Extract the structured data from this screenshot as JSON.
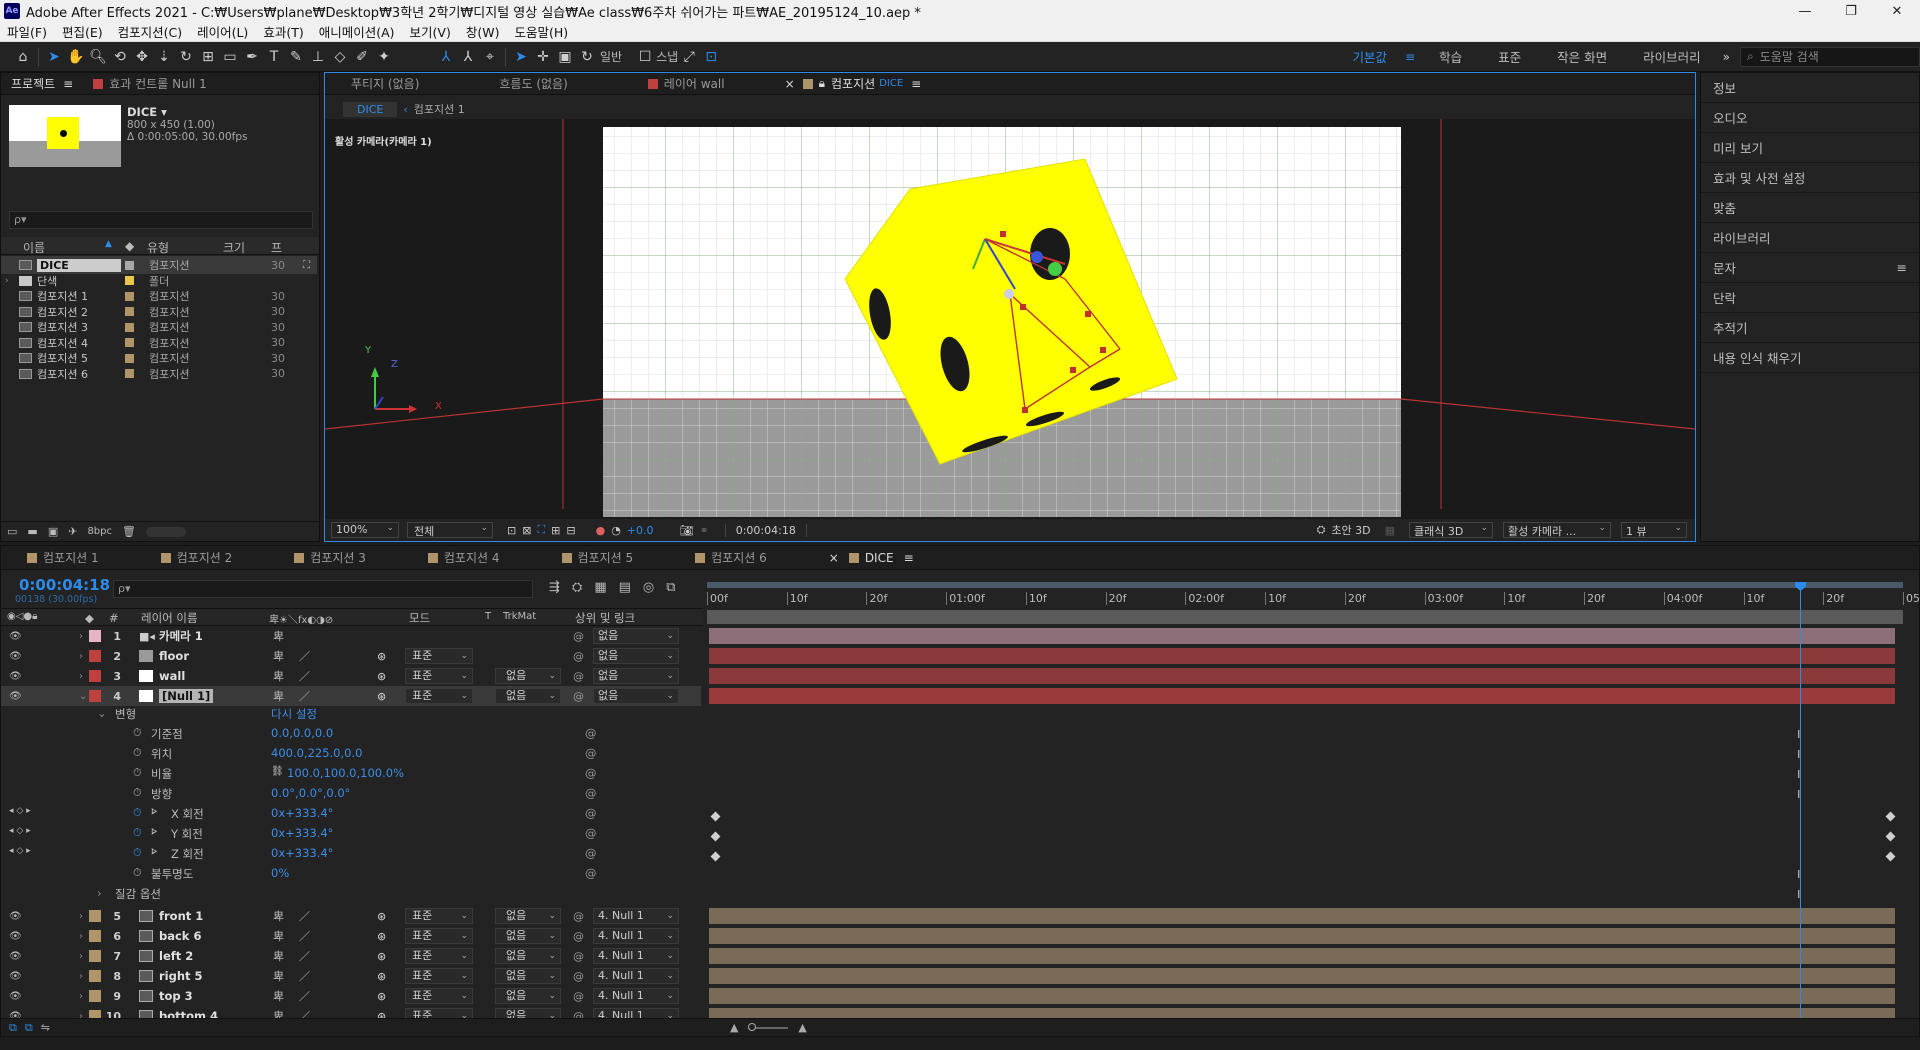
{
  "window": {
    "app_icon": "Ae",
    "title": "Adobe After Effects 2021 - C:₩Users₩plane₩Desktop₩3학년 2학기₩디지털 영상 실습₩Ae class₩6주차 쉬어가는 파트₩AE_20195124_10.aep *",
    "min": "—",
    "max": "❐",
    "close": "✕"
  },
  "menu": [
    "파일(F)",
    "편집(E)",
    "컴포지션(C)",
    "레이어(L)",
    "효과(T)",
    "애니메이션(A)",
    "보기(V)",
    "창(W)",
    "도움말(H)"
  ],
  "toolbar": {
    "snap_label": "스냅",
    "mode_label": "일반",
    "workspaces": [
      "기본값",
      "학습",
      "표준",
      "작은 화면",
      "라이브러리"
    ],
    "search_placeholder": "도움말 검색"
  },
  "project": {
    "tab": "프로젝트",
    "tab2": "효과 컨트롤 Null 1",
    "comp_name": "DICE ▾",
    "comp_size": "800 x 450 (1.00)",
    "comp_dur": "Δ 0:00:05:00, 30.00fps",
    "search_placeholder": "ρ▾",
    "cols": [
      "이름",
      "유형",
      "크기",
      "프"
    ],
    "items": [
      {
        "name": "DICE",
        "type": "컴포지션",
        "fps": "30",
        "kind": "comp",
        "label": "#a8a8a8"
      },
      {
        "name": "단색",
        "type": "폴더",
        "fps": "",
        "kind": "folder",
        "label": "#e8c84a"
      },
      {
        "name": "컴포지션 1",
        "type": "컴포지션",
        "fps": "30",
        "kind": "comp",
        "label": "#b0946a"
      },
      {
        "name": "컴포지션 2",
        "type": "컴포지션",
        "fps": "30",
        "kind": "comp",
        "label": "#b0946a"
      },
      {
        "name": "컴포지션 3",
        "type": "컴포지션",
        "fps": "30",
        "kind": "comp",
        "label": "#b0946a"
      },
      {
        "name": "컴포지션 4",
        "type": "컴포지션",
        "fps": "30",
        "kind": "comp",
        "label": "#b0946a"
      },
      {
        "name": "컴포지션 5",
        "type": "컴포지션",
        "fps": "30",
        "kind": "comp",
        "label": "#b0946a"
      },
      {
        "name": "컴포지션 6",
        "type": "컴포지션",
        "fps": "30",
        "kind": "comp",
        "label": "#b0946a"
      }
    ],
    "bpc": "8bpc"
  },
  "viewer": {
    "tabs": [
      "푸티지 (없음)",
      "흐름도 (없음)",
      "레이어 wall",
      "컴포지션"
    ],
    "active_tab_suffix": "DICE",
    "breadcrumb": [
      "DICE",
      "컴포지션 1"
    ],
    "camera_label": "활성 카메라(카메라 1)",
    "axis_y": "Y",
    "axis_x": "X",
    "axis_z": "Z",
    "zoom": "100%",
    "resolution": "전체",
    "exposure": "+0.0",
    "timecode": "0:00:04:18",
    "draft3d": "초안 3D",
    "renderer": "클래식 3D",
    "view": "활성 카메라 ...",
    "views": "1 뷰"
  },
  "right_panel": {
    "items": [
      "정보",
      "오디오",
      "미리 보기",
      "효과 및 사전 설정",
      "맞춤",
      "라이브러리",
      "문자",
      "단락",
      "추적기",
      "내용 인식 채우기"
    ]
  },
  "timeline": {
    "tabs": [
      "컴포지션 1",
      "컴포지션 2",
      "컴포지션 3",
      "컴포지션 4",
      "컴포지션 5",
      "컴포지션 6",
      "DICE"
    ],
    "timecode": "0:00:04:18",
    "frame_info": "00138 (30.00fps)",
    "search_placeholder": "ρ▾",
    "col_headers": {
      "layer": "레이어 이름",
      "mode": "모드",
      "t": "T",
      "trkmat": "TrkMat",
      "parent": "상위 및 링크"
    },
    "ruler": [
      "00f",
      "10f",
      "20f",
      "01:00f",
      "10f",
      "20f",
      "02:00f",
      "10f",
      "20f",
      "03:00f",
      "10f",
      "20f",
      "04:00f",
      "10f",
      "20f",
      "05:0"
    ],
    "layers": [
      {
        "num": "1",
        "name": "카메라 1",
        "color": "#e8b4c4",
        "mode": "",
        "trk": "",
        "parent": "없음",
        "bar": "#8c6f78",
        "kind": "camera"
      },
      {
        "num": "2",
        "name": "floor",
        "color": "#c04040",
        "mode": "표준",
        "trk": "",
        "parent": "없음",
        "bar": "#8a3a3a",
        "kind": "solid_gray"
      },
      {
        "num": "3",
        "name": "wall",
        "color": "#c04040",
        "mode": "표준",
        "trk": "없음",
        "parent": "없음",
        "bar": "#8a3a3a",
        "kind": "solid_white"
      },
      {
        "num": "4",
        "name": "[Null 1]",
        "color": "#c04040",
        "mode": "표준",
        "trk": "없음",
        "parent": "없음",
        "bar": "#9a3a3a",
        "kind": "null",
        "selected": true
      }
    ],
    "transform": {
      "group": "변형",
      "reset": "다시 설정",
      "props": [
        {
          "name": "기준점",
          "value": "0.0,0.0,0.0",
          "kf": false
        },
        {
          "name": "위치",
          "value": "400.0,225.0,0.0",
          "kf": false
        },
        {
          "name": "비율",
          "value": "100.0,100.0,100.0%",
          "kf": false,
          "link": true
        },
        {
          "name": "방향",
          "value": "0.0°,0.0°,0.0°",
          "kf": false
        },
        {
          "name": "X 회전",
          "value": "0x+333.4°",
          "kf": true
        },
        {
          "name": "Y 회전",
          "value": "0x+333.4°",
          "kf": true
        },
        {
          "name": "Z 회전",
          "value": "0x+333.4°",
          "kf": true
        },
        {
          "name": "불투명도",
          "value": "0%",
          "kf": false
        }
      ],
      "material": "질감 옵션"
    },
    "sublayers": [
      {
        "num": "5",
        "name": "front 1",
        "mode": "표준",
        "trk": "없음",
        "parent": "4. Null 1"
      },
      {
        "num": "6",
        "name": "back 6",
        "mode": "표준",
        "trk": "없음",
        "parent": "4. Null 1"
      },
      {
        "num": "7",
        "name": "left 2",
        "mode": "표준",
        "trk": "없음",
        "parent": "4. Null 1"
      },
      {
        "num": "8",
        "name": "right 5",
        "mode": "표준",
        "trk": "없음",
        "parent": "4. Null 1"
      },
      {
        "num": "9",
        "name": "top 3",
        "mode": "표준",
        "trk": "없음",
        "parent": "4. Null 1"
      },
      {
        "num": "10",
        "name": "bottom 4",
        "mode": "표준",
        "trk": "없음",
        "parent": "4. Null 1"
      }
    ],
    "sub_color": "#b0946a",
    "sub_bar": "#7a6a58",
    "playhead_fraction": 0.92
  }
}
